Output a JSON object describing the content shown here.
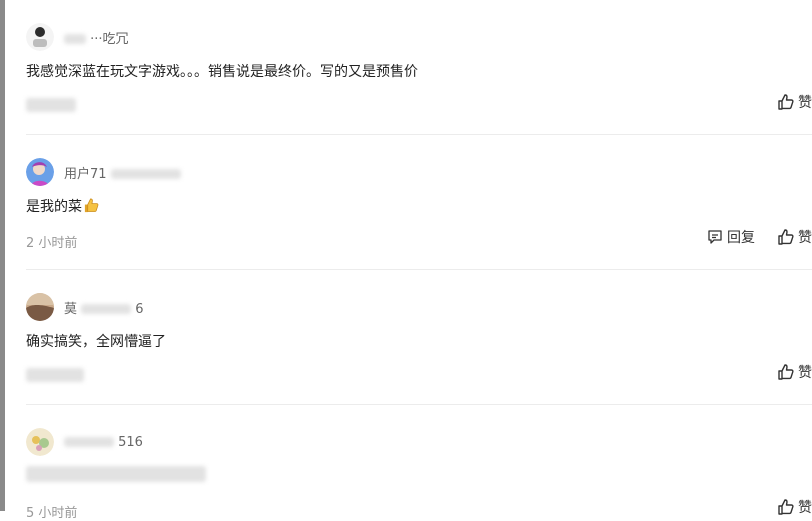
{
  "comments": [
    {
      "username_visible": "···吃冗",
      "text": "我感觉深蓝在玩文字游戏。。。销售说是最终价。写的又是预售价",
      "time": "",
      "reply_label": "",
      "like_label": "赞"
    },
    {
      "username_visible": "用户71",
      "text": "是我的菜",
      "emoji_icon": "thumbs-up-emoji",
      "time": "2 小时前",
      "reply_label": "回复",
      "like_label": "赞"
    },
    {
      "username_visible": "莫",
      "username_tail": "6",
      "text": "确实搞笑，全网懵逼了",
      "time": "",
      "reply_label": "",
      "like_label": "赞"
    },
    {
      "username_visible": "",
      "username_tail": "516",
      "text": "",
      "time": "5 小时前",
      "reply_label": "",
      "like_label": "赞"
    }
  ],
  "colors": {
    "text": "#222222",
    "meta": "#999999",
    "divider": "#ececec"
  },
  "icons": {
    "reply": "comment-icon",
    "like": "thumbs-up-icon"
  }
}
